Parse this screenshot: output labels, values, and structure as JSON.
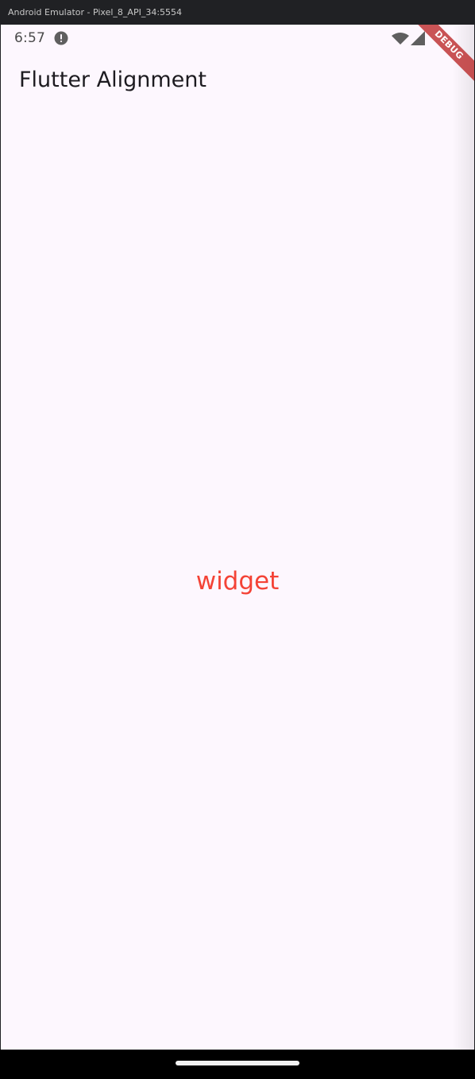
{
  "window": {
    "title": "Android Emulator - Pixel_8_API_34:5554"
  },
  "status_bar": {
    "time": "6:57",
    "icons": [
      "alert-icon",
      "wifi-icon",
      "signal-icon"
    ]
  },
  "app_bar": {
    "title": "Flutter Alignment"
  },
  "body": {
    "text": "widget",
    "text_color": "#f44336"
  },
  "debug_banner": {
    "label": "DEBUG",
    "color": "#b71c1c"
  },
  "nav_bar": {
    "handle": "home-gesture-handle"
  },
  "colors": {
    "background": "#fdf7fe",
    "title_text": "#1d1b20",
    "window_chrome": "#202124"
  }
}
